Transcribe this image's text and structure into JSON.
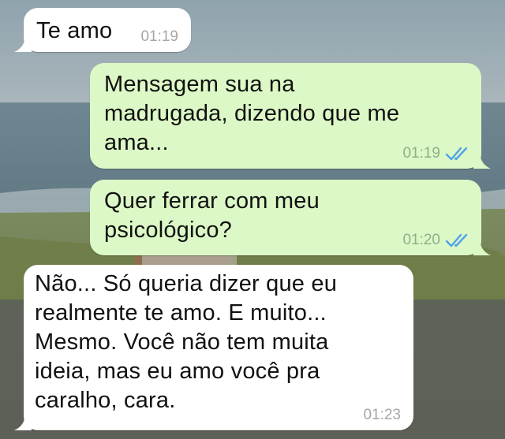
{
  "messages": [
    {
      "direction": "incoming",
      "text": "Te amo",
      "time": "01:19"
    },
    {
      "direction": "outgoing",
      "text": "Mensagem sua na\nmadrugada, dizendo que me\nama...",
      "time": "01:19",
      "status": "read-double-check-icon"
    },
    {
      "direction": "outgoing",
      "text": "Quer ferrar com meu\npsicológico?",
      "time": "01:20",
      "status": "read-double-check-icon"
    },
    {
      "direction": "incoming",
      "text": "Não... Só queria dizer que eu\nrealmente te amo. E muito...\nMesmo. Você não tem muita\nideia, mas eu amo você pra\ncaralho, cara.",
      "time": "01:23"
    }
  ],
  "colors": {
    "incoming_bubble": "#ffffff",
    "outgoing_bubble": "#dcf8c6",
    "read_ticks": "#4fa3e8"
  }
}
